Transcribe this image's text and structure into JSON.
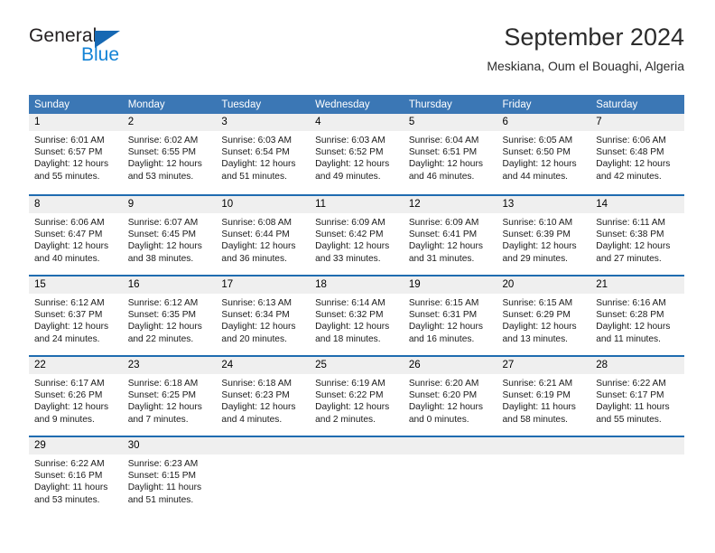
{
  "brand": {
    "name_top": "General",
    "name_bottom": "Blue",
    "triangle_color": "#1668b3",
    "blue_color": "#1383d6"
  },
  "header": {
    "title": "September 2024",
    "subtitle": "Meskiana, Oum el Bouaghi, Algeria"
  },
  "theme": {
    "header_bg": "#3b77b5",
    "row_separator": "#1f6cb0",
    "daynum_bg": "#efefef"
  },
  "calendar": {
    "weekdays": [
      "Sunday",
      "Monday",
      "Tuesday",
      "Wednesday",
      "Thursday",
      "Friday",
      "Saturday"
    ],
    "weeks": [
      [
        {
          "day": "1",
          "sunrise": "Sunrise: 6:01 AM",
          "sunset": "Sunset: 6:57 PM",
          "daylight1": "Daylight: 12 hours",
          "daylight2": "and 55 minutes."
        },
        {
          "day": "2",
          "sunrise": "Sunrise: 6:02 AM",
          "sunset": "Sunset: 6:55 PM",
          "daylight1": "Daylight: 12 hours",
          "daylight2": "and 53 minutes."
        },
        {
          "day": "3",
          "sunrise": "Sunrise: 6:03 AM",
          "sunset": "Sunset: 6:54 PM",
          "daylight1": "Daylight: 12 hours",
          "daylight2": "and 51 minutes."
        },
        {
          "day": "4",
          "sunrise": "Sunrise: 6:03 AM",
          "sunset": "Sunset: 6:52 PM",
          "daylight1": "Daylight: 12 hours",
          "daylight2": "and 49 minutes."
        },
        {
          "day": "5",
          "sunrise": "Sunrise: 6:04 AM",
          "sunset": "Sunset: 6:51 PM",
          "daylight1": "Daylight: 12 hours",
          "daylight2": "and 46 minutes."
        },
        {
          "day": "6",
          "sunrise": "Sunrise: 6:05 AM",
          "sunset": "Sunset: 6:50 PM",
          "daylight1": "Daylight: 12 hours",
          "daylight2": "and 44 minutes."
        },
        {
          "day": "7",
          "sunrise": "Sunrise: 6:06 AM",
          "sunset": "Sunset: 6:48 PM",
          "daylight1": "Daylight: 12 hours",
          "daylight2": "and 42 minutes."
        }
      ],
      [
        {
          "day": "8",
          "sunrise": "Sunrise: 6:06 AM",
          "sunset": "Sunset: 6:47 PM",
          "daylight1": "Daylight: 12 hours",
          "daylight2": "and 40 minutes."
        },
        {
          "day": "9",
          "sunrise": "Sunrise: 6:07 AM",
          "sunset": "Sunset: 6:45 PM",
          "daylight1": "Daylight: 12 hours",
          "daylight2": "and 38 minutes."
        },
        {
          "day": "10",
          "sunrise": "Sunrise: 6:08 AM",
          "sunset": "Sunset: 6:44 PM",
          "daylight1": "Daylight: 12 hours",
          "daylight2": "and 36 minutes."
        },
        {
          "day": "11",
          "sunrise": "Sunrise: 6:09 AM",
          "sunset": "Sunset: 6:42 PM",
          "daylight1": "Daylight: 12 hours",
          "daylight2": "and 33 minutes."
        },
        {
          "day": "12",
          "sunrise": "Sunrise: 6:09 AM",
          "sunset": "Sunset: 6:41 PM",
          "daylight1": "Daylight: 12 hours",
          "daylight2": "and 31 minutes."
        },
        {
          "day": "13",
          "sunrise": "Sunrise: 6:10 AM",
          "sunset": "Sunset: 6:39 PM",
          "daylight1": "Daylight: 12 hours",
          "daylight2": "and 29 minutes."
        },
        {
          "day": "14",
          "sunrise": "Sunrise: 6:11 AM",
          "sunset": "Sunset: 6:38 PM",
          "daylight1": "Daylight: 12 hours",
          "daylight2": "and 27 minutes."
        }
      ],
      [
        {
          "day": "15",
          "sunrise": "Sunrise: 6:12 AM",
          "sunset": "Sunset: 6:37 PM",
          "daylight1": "Daylight: 12 hours",
          "daylight2": "and 24 minutes."
        },
        {
          "day": "16",
          "sunrise": "Sunrise: 6:12 AM",
          "sunset": "Sunset: 6:35 PM",
          "daylight1": "Daylight: 12 hours",
          "daylight2": "and 22 minutes."
        },
        {
          "day": "17",
          "sunrise": "Sunrise: 6:13 AM",
          "sunset": "Sunset: 6:34 PM",
          "daylight1": "Daylight: 12 hours",
          "daylight2": "and 20 minutes."
        },
        {
          "day": "18",
          "sunrise": "Sunrise: 6:14 AM",
          "sunset": "Sunset: 6:32 PM",
          "daylight1": "Daylight: 12 hours",
          "daylight2": "and 18 minutes."
        },
        {
          "day": "19",
          "sunrise": "Sunrise: 6:15 AM",
          "sunset": "Sunset: 6:31 PM",
          "daylight1": "Daylight: 12 hours",
          "daylight2": "and 16 minutes."
        },
        {
          "day": "20",
          "sunrise": "Sunrise: 6:15 AM",
          "sunset": "Sunset: 6:29 PM",
          "daylight1": "Daylight: 12 hours",
          "daylight2": "and 13 minutes."
        },
        {
          "day": "21",
          "sunrise": "Sunrise: 6:16 AM",
          "sunset": "Sunset: 6:28 PM",
          "daylight1": "Daylight: 12 hours",
          "daylight2": "and 11 minutes."
        }
      ],
      [
        {
          "day": "22",
          "sunrise": "Sunrise: 6:17 AM",
          "sunset": "Sunset: 6:26 PM",
          "daylight1": "Daylight: 12 hours",
          "daylight2": "and 9 minutes."
        },
        {
          "day": "23",
          "sunrise": "Sunrise: 6:18 AM",
          "sunset": "Sunset: 6:25 PM",
          "daylight1": "Daylight: 12 hours",
          "daylight2": "and 7 minutes."
        },
        {
          "day": "24",
          "sunrise": "Sunrise: 6:18 AM",
          "sunset": "Sunset: 6:23 PM",
          "daylight1": "Daylight: 12 hours",
          "daylight2": "and 4 minutes."
        },
        {
          "day": "25",
          "sunrise": "Sunrise: 6:19 AM",
          "sunset": "Sunset: 6:22 PM",
          "daylight1": "Daylight: 12 hours",
          "daylight2": "and 2 minutes."
        },
        {
          "day": "26",
          "sunrise": "Sunrise: 6:20 AM",
          "sunset": "Sunset: 6:20 PM",
          "daylight1": "Daylight: 12 hours",
          "daylight2": "and 0 minutes."
        },
        {
          "day": "27",
          "sunrise": "Sunrise: 6:21 AM",
          "sunset": "Sunset: 6:19 PM",
          "daylight1": "Daylight: 11 hours",
          "daylight2": "and 58 minutes."
        },
        {
          "day": "28",
          "sunrise": "Sunrise: 6:22 AM",
          "sunset": "Sunset: 6:17 PM",
          "daylight1": "Daylight: 11 hours",
          "daylight2": "and 55 minutes."
        }
      ],
      [
        {
          "day": "29",
          "sunrise": "Sunrise: 6:22 AM",
          "sunset": "Sunset: 6:16 PM",
          "daylight1": "Daylight: 11 hours",
          "daylight2": "and 53 minutes."
        },
        {
          "day": "30",
          "sunrise": "Sunrise: 6:23 AM",
          "sunset": "Sunset: 6:15 PM",
          "daylight1": "Daylight: 11 hours",
          "daylight2": "and 51 minutes."
        },
        {
          "day": "",
          "sunrise": "",
          "sunset": "",
          "daylight1": "",
          "daylight2": ""
        },
        {
          "day": "",
          "sunrise": "",
          "sunset": "",
          "daylight1": "",
          "daylight2": ""
        },
        {
          "day": "",
          "sunrise": "",
          "sunset": "",
          "daylight1": "",
          "daylight2": ""
        },
        {
          "day": "",
          "sunrise": "",
          "sunset": "",
          "daylight1": "",
          "daylight2": ""
        },
        {
          "day": "",
          "sunrise": "",
          "sunset": "",
          "daylight1": "",
          "daylight2": ""
        }
      ]
    ]
  }
}
